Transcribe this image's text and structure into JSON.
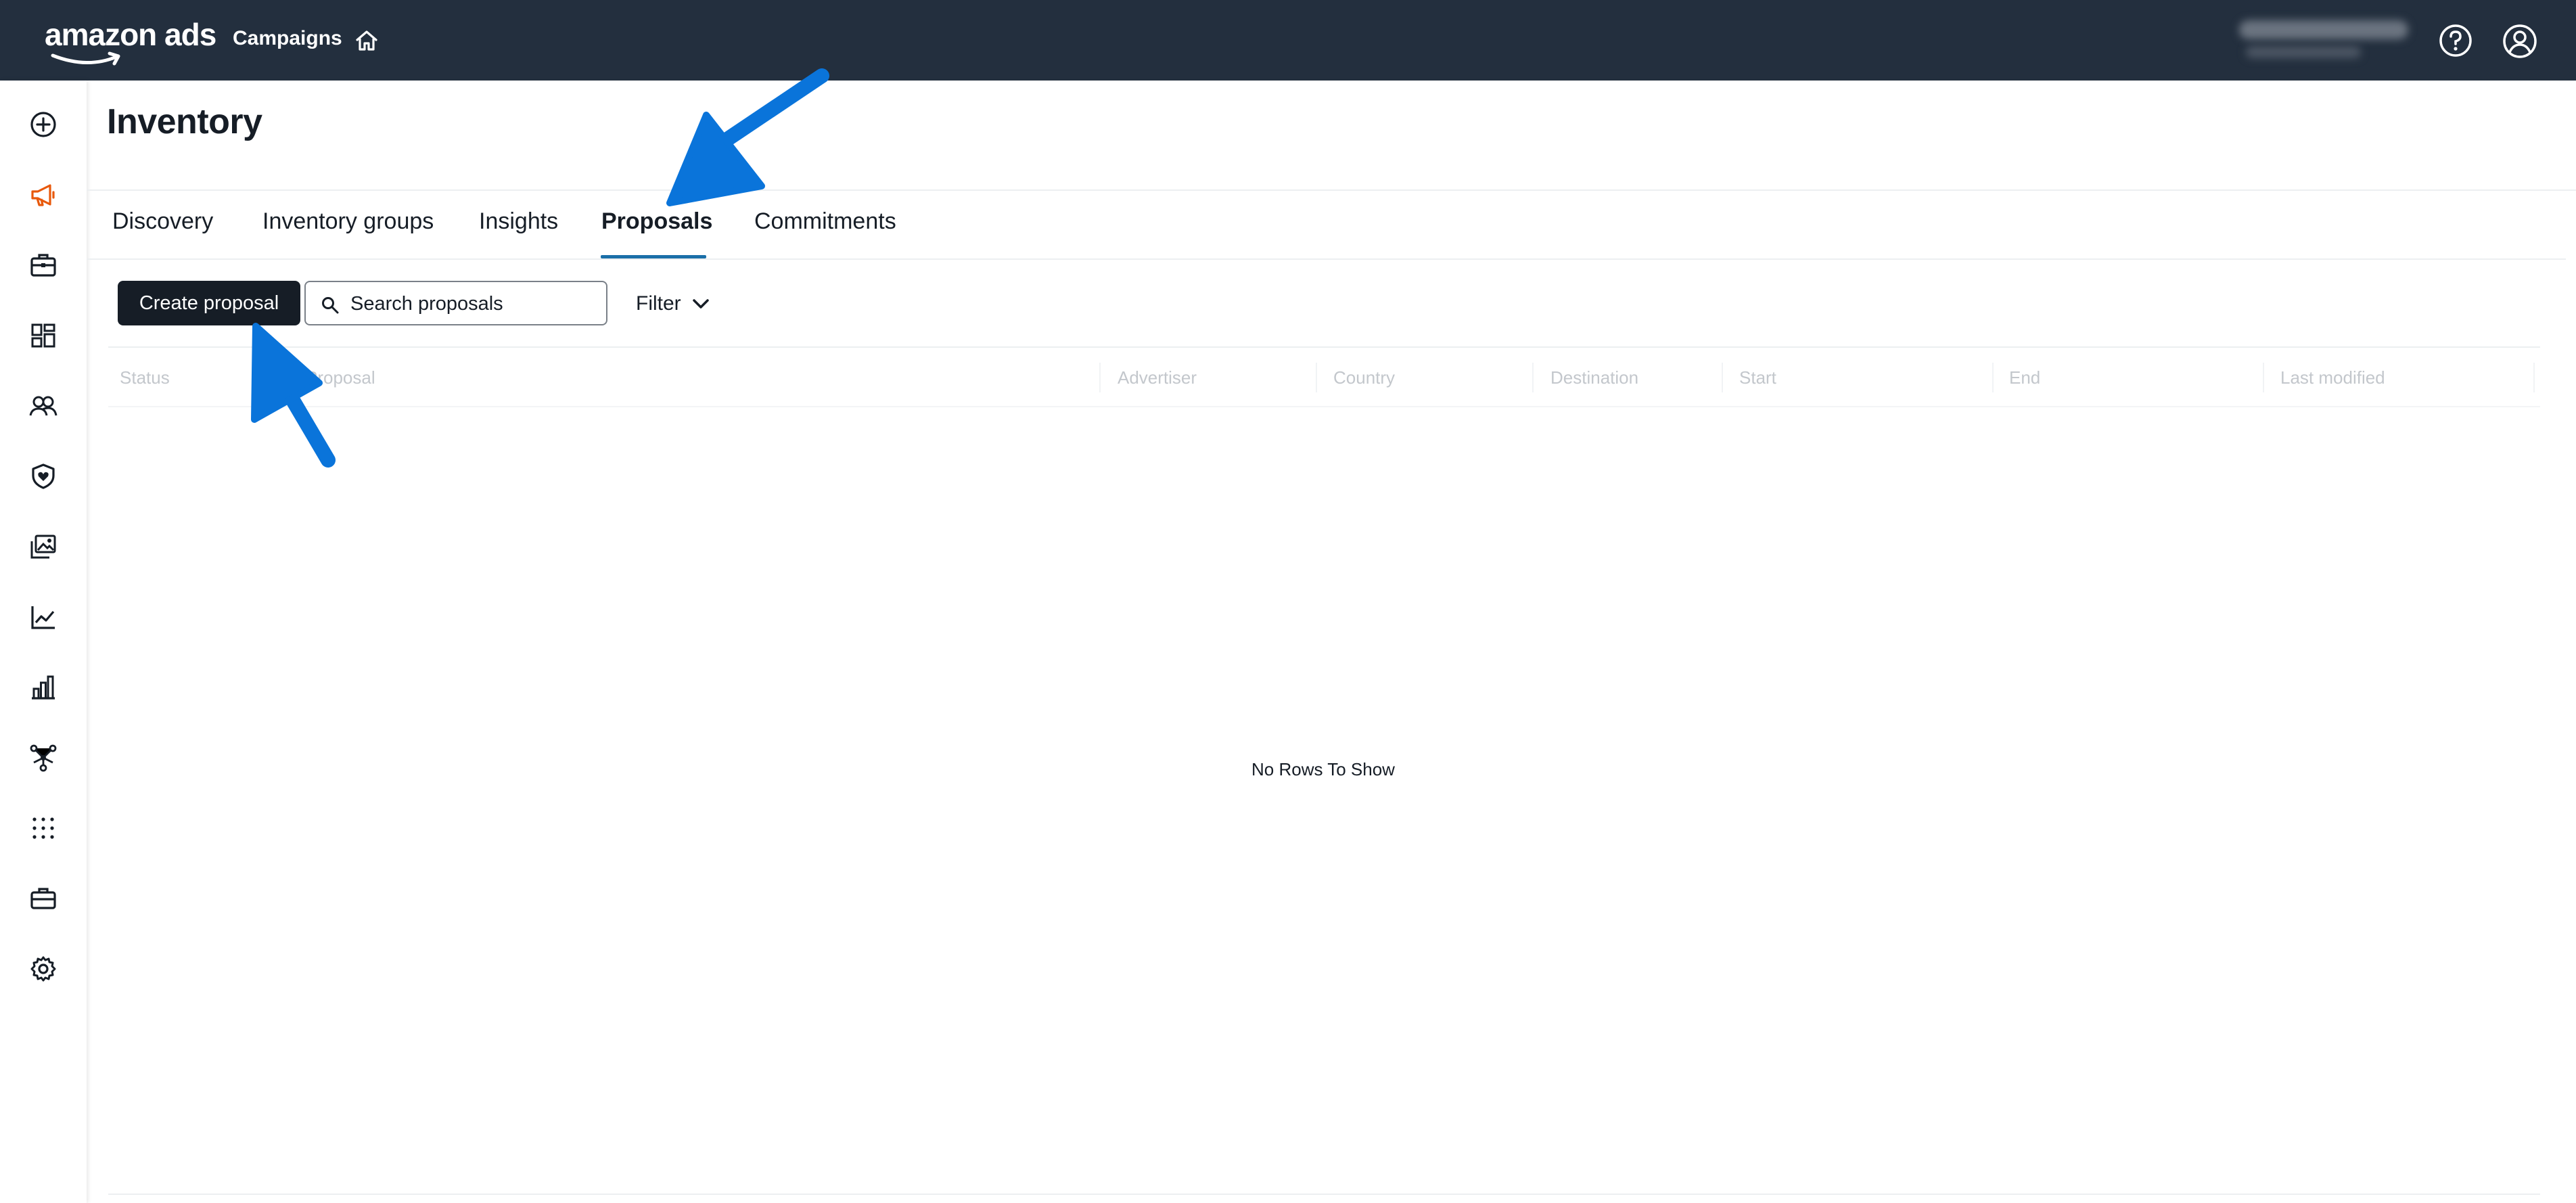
{
  "header": {
    "logo_text": "amazon ads",
    "nav_campaigns": "Campaigns",
    "icons": [
      "home-icon",
      "help-icon",
      "user-account-icon"
    ]
  },
  "sidebar": {
    "items": [
      {
        "icon": "plus-circle-icon"
      },
      {
        "icon": "megaphone-icon",
        "active": true
      },
      {
        "icon": "briefcase-icon"
      },
      {
        "icon": "dashboard-icon"
      },
      {
        "icon": "people-icon"
      },
      {
        "icon": "shield-heart-icon"
      },
      {
        "icon": "images-icon"
      },
      {
        "icon": "line-chart-icon"
      },
      {
        "icon": "bar-chart-icon"
      },
      {
        "icon": "network-icon"
      },
      {
        "icon": "apps-grid-icon"
      },
      {
        "icon": "toolbox-icon"
      },
      {
        "icon": "gear-icon"
      }
    ]
  },
  "page": {
    "title": "Inventory",
    "tabs": [
      {
        "label": "Discovery"
      },
      {
        "label": "Inventory groups"
      },
      {
        "label": "Insights"
      },
      {
        "label": "Proposals",
        "active": true
      },
      {
        "label": "Commitments"
      }
    ]
  },
  "toolbar": {
    "create_label": "Create proposal",
    "search_placeholder": "Search proposals",
    "filter_label": "Filter"
  },
  "table": {
    "columns": [
      "Status",
      "Proposal",
      "Advertiser",
      "Country",
      "Destination",
      "Start",
      "End",
      "Last modified"
    ],
    "empty_text": "No Rows To Show"
  },
  "colors": {
    "header_bg": "#232f3e",
    "accent": "#1a6fa8",
    "primary_button": "#161d26",
    "sidebar_active": "#e8590c",
    "annotation_arrow": "#0a74da"
  }
}
